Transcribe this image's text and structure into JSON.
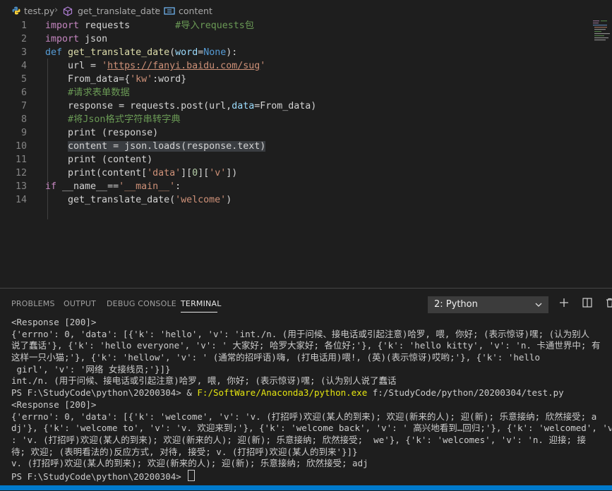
{
  "breadcrumb": {
    "file": "test.py",
    "function": "get_translate_date",
    "symbol": "content"
  },
  "editor": {
    "lines": [
      {
        "n": "1",
        "parts": [
          [
            "kw",
            "import"
          ],
          [
            "txt",
            " requests"
          ],
          [
            "txt",
            "        "
          ],
          [
            "cmt",
            "#导入requests包"
          ]
        ]
      },
      {
        "n": "2",
        "parts": [
          [
            "kw",
            "import"
          ],
          [
            "txt",
            " json"
          ]
        ]
      },
      {
        "n": "3",
        "parts": [
          [
            "kwb",
            "def"
          ],
          [
            "txt",
            " "
          ],
          [
            "fn",
            "get_translate_date"
          ],
          [
            "txt",
            "("
          ],
          [
            "prm",
            "word"
          ],
          [
            "txt",
            "="
          ],
          [
            "kwb",
            "None"
          ],
          [
            "txt",
            "):"
          ]
        ]
      },
      {
        "n": "4",
        "parts": [
          [
            "txt",
            "    url = "
          ],
          [
            "str",
            "'"
          ],
          [
            "url",
            "https://fanyi.baidu.com/sug"
          ],
          [
            "str",
            "'"
          ]
        ]
      },
      {
        "n": "5",
        "parts": [
          [
            "txt",
            "    From_data={"
          ],
          [
            "str",
            "'kw'"
          ],
          [
            "txt",
            ":word}"
          ]
        ]
      },
      {
        "n": "6",
        "parts": [
          [
            "txt",
            "    "
          ],
          [
            "cmt",
            "#请求表单数据"
          ]
        ]
      },
      {
        "n": "7",
        "parts": [
          [
            "txt",
            "    response = requests.post(url,"
          ],
          [
            "prm",
            "data"
          ],
          [
            "txt",
            "=From_data)"
          ]
        ]
      },
      {
        "n": "8",
        "parts": [
          [
            "txt",
            "    "
          ],
          [
            "cmt",
            "#将Json格式字符串转字典"
          ]
        ]
      },
      {
        "n": "9",
        "parts": [
          [
            "txt",
            "    print (response)"
          ]
        ]
      },
      {
        "n": "10",
        "hl": true,
        "parts": [
          [
            "txt",
            "    content = json.loads(response.text)"
          ]
        ]
      },
      {
        "n": "11",
        "parts": [
          [
            "txt",
            "    print (content)"
          ]
        ]
      },
      {
        "n": "12",
        "parts": [
          [
            "txt",
            "    print(content["
          ],
          [
            "str",
            "'data'"
          ],
          [
            "txt",
            "]["
          ],
          [
            "num",
            "0"
          ],
          [
            "txt",
            "]["
          ],
          [
            "str",
            "'v'"
          ],
          [
            "txt",
            "])"
          ]
        ]
      },
      {
        "n": "13",
        "parts": [
          [
            "kw",
            "if"
          ],
          [
            "txt",
            " __name__=="
          ],
          [
            "str",
            "'__main__'"
          ],
          [
            "txt",
            ":"
          ]
        ]
      },
      {
        "n": "14",
        "parts": [
          [
            "txt",
            "    get_translate_date("
          ],
          [
            "str",
            "'welcome'"
          ],
          [
            "txt",
            ")"
          ]
        ]
      }
    ]
  },
  "panel": {
    "tabs": [
      "PROBLEMS",
      "OUTPUT",
      "DEBUG CONSOLE",
      "TERMINAL"
    ],
    "active_tab": "TERMINAL",
    "terminal_select": "2: Python",
    "terminal_lines": [
      "<Response [200]>",
      "{'errno': 0, 'data': [{'k': 'hello', 'v': 'int./n. (用于问候、接电话或引起注意)哈罗, 喂, 你好; (表示惊讶)嘿; (认为别人",
      "说了蠢话'}, {'k': 'hello everyone', 'v': ' 大家好; 哈罗大家好; 各位好;'}, {'k': 'hello kitty', 'v': 'n. 卡通世界中; 有",
      "这样一只小猫;'}, {'k': 'hellow', 'v': ' (通常的招呼语)嗨, (打电话用)喂!, (英)(表示惊讶)哎哟;'}, {'k': 'hello",
      " girl', 'v': '网络 女接线员;'}]}",
      "int./n. (用于问候、接电话或引起注意)哈罗, 喂, 你好; (表示惊讶)嘿; (认为别人说了蠢话",
      "PS F:\\StudyCode\\python\\20200304> & ",
      "<Response [200]>",
      "{'errno': 0, 'data': [{'k': 'welcome', 'v': 'v. (打招呼)欢迎(某人的到来); 欢迎(新来的人); 迎(新); 乐意接纳; 欣然接受; a",
      "dj'}, {'k': 'welcome to', 'v': 'v. 欢迎来到;'}, {'k': 'welcome back', 'v': ' 高兴地看到…回归;'}, {'k': 'welcomed', 'v'",
      ": 'v. (打招呼)欢迎(某人的到来); 欢迎(新来的人); 迎(新); 乐意接纳; 欣然接受;  we'}, {'k': 'welcomes', 'v': 'n. 迎接; 接",
      "待; 欢迎; (表明看法的)反应方式, 对待, 接受; v. (打招呼)欢迎(某人的到来'}]}",
      "v. (打招呼)欢迎(某人的到来); 欢迎(新来的人); 迎(新); 乐意接纳; 欣然接受; adj",
      "PS F:\\StudyCode\\python\\20200304> "
    ],
    "run_exe": "F:/SoftWare/Anaconda3/python.exe",
    "run_arg": " f:/StudyCode/python/20200304/test.py"
  },
  "colors": {
    "accent": "#007acc",
    "background": "#1e1e1e",
    "highlight_line": "#3a3d41"
  }
}
